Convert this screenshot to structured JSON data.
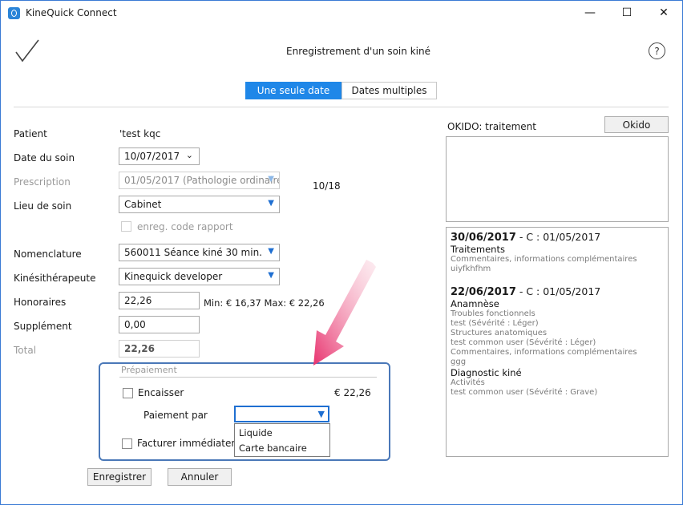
{
  "window": {
    "title": "KineQuick Connect",
    "minimize": "—",
    "maximize": "☐",
    "close": "✕"
  },
  "header": {
    "title": "Enregistrement d'un soin kiné",
    "help": "?"
  },
  "tabs": [
    {
      "label": "Une seule date",
      "active": true
    },
    {
      "label": "Dates multiples",
      "active": false
    }
  ],
  "form": {
    "patient_label": "Patient",
    "patient_value": "'test kqc",
    "date_label": "Date du soin",
    "date_value": "10/07/2017",
    "prescription_label": "Prescription",
    "prescription_value": "01/05/2017 (Pathologie ordinaire",
    "prescription_count": "10/18",
    "lieu_label": "Lieu de soin",
    "lieu_value": "Cabinet",
    "code_rapport_label": "enreg. code rapport",
    "nomenclature_label": "Nomenclature",
    "nomenclature_value": "560011 Séance kiné 30 min.",
    "kine_label": "Kinésithérapeute",
    "kine_value": "Kinequick developer",
    "honoraires_label": "Honoraires",
    "honoraires_value": "22,26",
    "honoraires_range": "Min: € 16,37 Max: € 22,26",
    "supplement_label": "Supplément",
    "supplement_value": "0,00",
    "total_label": "Total",
    "total_value": "22,26"
  },
  "prepaiement": {
    "title": "Prépaiement",
    "encaisser_label": "Encaisser",
    "amount": "€ 22,26",
    "paiement_label": "Paiement par",
    "paiement_value": "",
    "options": [
      "Liquide",
      "Carte bancaire"
    ],
    "facturer_label": "Facturer immédiatem"
  },
  "actions": {
    "save": "Enregistrer",
    "cancel": "Annuler"
  },
  "okido": {
    "label": "OKIDO: traitement",
    "button": "Okido"
  },
  "history": [
    {
      "date": "30/06/2017",
      "sub": " - C : 01/05/2017",
      "lines": [
        {
          "t": "Traitements",
          "k": "head"
        },
        {
          "t": "Commentaires, informations complémentaires",
          "k": "small"
        },
        {
          "t": "uiyfkhfhm",
          "k": "small"
        }
      ]
    },
    {
      "date": "22/06/2017",
      "sub": " - C : 01/05/2017",
      "lines": [
        {
          "t": "Anamnèse",
          "k": "head"
        },
        {
          "t": "Troubles fonctionnels",
          "k": "small"
        },
        {
          "t": "test (Sévérité : Léger)",
          "k": "small"
        },
        {
          "t": "Structures anatomiques",
          "k": "small"
        },
        {
          "t": "test common user (Sévérité : Léger)",
          "k": "small"
        },
        {
          "t": "Commentaires, informations complémentaires",
          "k": "small"
        },
        {
          "t": "ggg",
          "k": "small"
        },
        {
          "t": "Diagnostic kiné",
          "k": "head"
        },
        {
          "t": "Activités",
          "k": "small"
        },
        {
          "t": "test common user (Sévérité : Grave)",
          "k": "small"
        }
      ]
    }
  ],
  "colors": {
    "accent": "#1f87e8",
    "highlight_border": "#4a78b8",
    "arrow": "#e8326e"
  }
}
